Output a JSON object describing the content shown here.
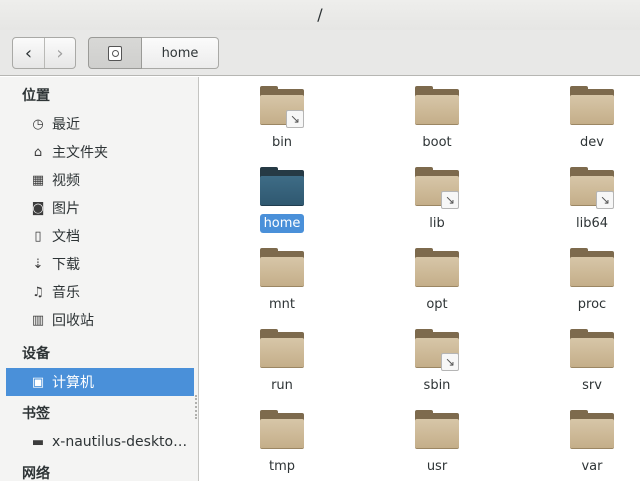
{
  "window": {
    "title": "/"
  },
  "toolbar": {
    "back_icon": "‹",
    "forward_icon": "›",
    "path": [
      {
        "kind": "root",
        "icon": "computer-drive-icon"
      },
      {
        "kind": "segment",
        "label": "home"
      }
    ]
  },
  "sidebar": {
    "sections": [
      {
        "heading": "位置",
        "items": [
          {
            "label": "最近",
            "icon": "clock-icon",
            "glyph": "◷"
          },
          {
            "label": "主文件夹",
            "icon": "home-icon",
            "glyph": "⌂"
          },
          {
            "label": "视频",
            "icon": "film-icon",
            "glyph": "▦"
          },
          {
            "label": "图片",
            "icon": "camera-icon",
            "glyph": "◙"
          },
          {
            "label": "文档",
            "icon": "document-icon",
            "glyph": "▯"
          },
          {
            "label": "下载",
            "icon": "download-icon",
            "glyph": "⇣"
          },
          {
            "label": "音乐",
            "icon": "music-icon",
            "glyph": "♫"
          },
          {
            "label": "回收站",
            "icon": "trash-icon",
            "glyph": "▥"
          }
        ]
      },
      {
        "heading": "设备",
        "items": [
          {
            "label": "计算机",
            "icon": "computer-drive-icon",
            "glyph": "▣",
            "selected": true
          }
        ]
      },
      {
        "heading": "书签",
        "items": [
          {
            "label": "x-nautilus-desktop:///",
            "icon": "folder-icon",
            "glyph": "▬"
          }
        ]
      },
      {
        "heading": "网络",
        "items": []
      }
    ]
  },
  "files": [
    {
      "name": "bin",
      "symlink": true
    },
    {
      "name": "boot",
      "symlink": false
    },
    {
      "name": "dev",
      "symlink": false
    },
    {
      "name": "home",
      "symlink": false,
      "selected": true
    },
    {
      "name": "lib",
      "symlink": true
    },
    {
      "name": "lib64",
      "symlink": true
    },
    {
      "name": "mnt",
      "symlink": false
    },
    {
      "name": "opt",
      "symlink": false
    },
    {
      "name": "proc",
      "symlink": false
    },
    {
      "name": "run",
      "symlink": false
    },
    {
      "name": "sbin",
      "symlink": true
    },
    {
      "name": "srv",
      "symlink": false
    },
    {
      "name": "tmp",
      "symlink": false
    },
    {
      "name": "usr",
      "symlink": false
    },
    {
      "name": "var",
      "symlink": false
    }
  ],
  "colors": {
    "selection": "#4a90d9",
    "folder": "#c4ae89",
    "folder_selected": "#2f5870",
    "sidebar_bg": "#f4f4f3"
  }
}
